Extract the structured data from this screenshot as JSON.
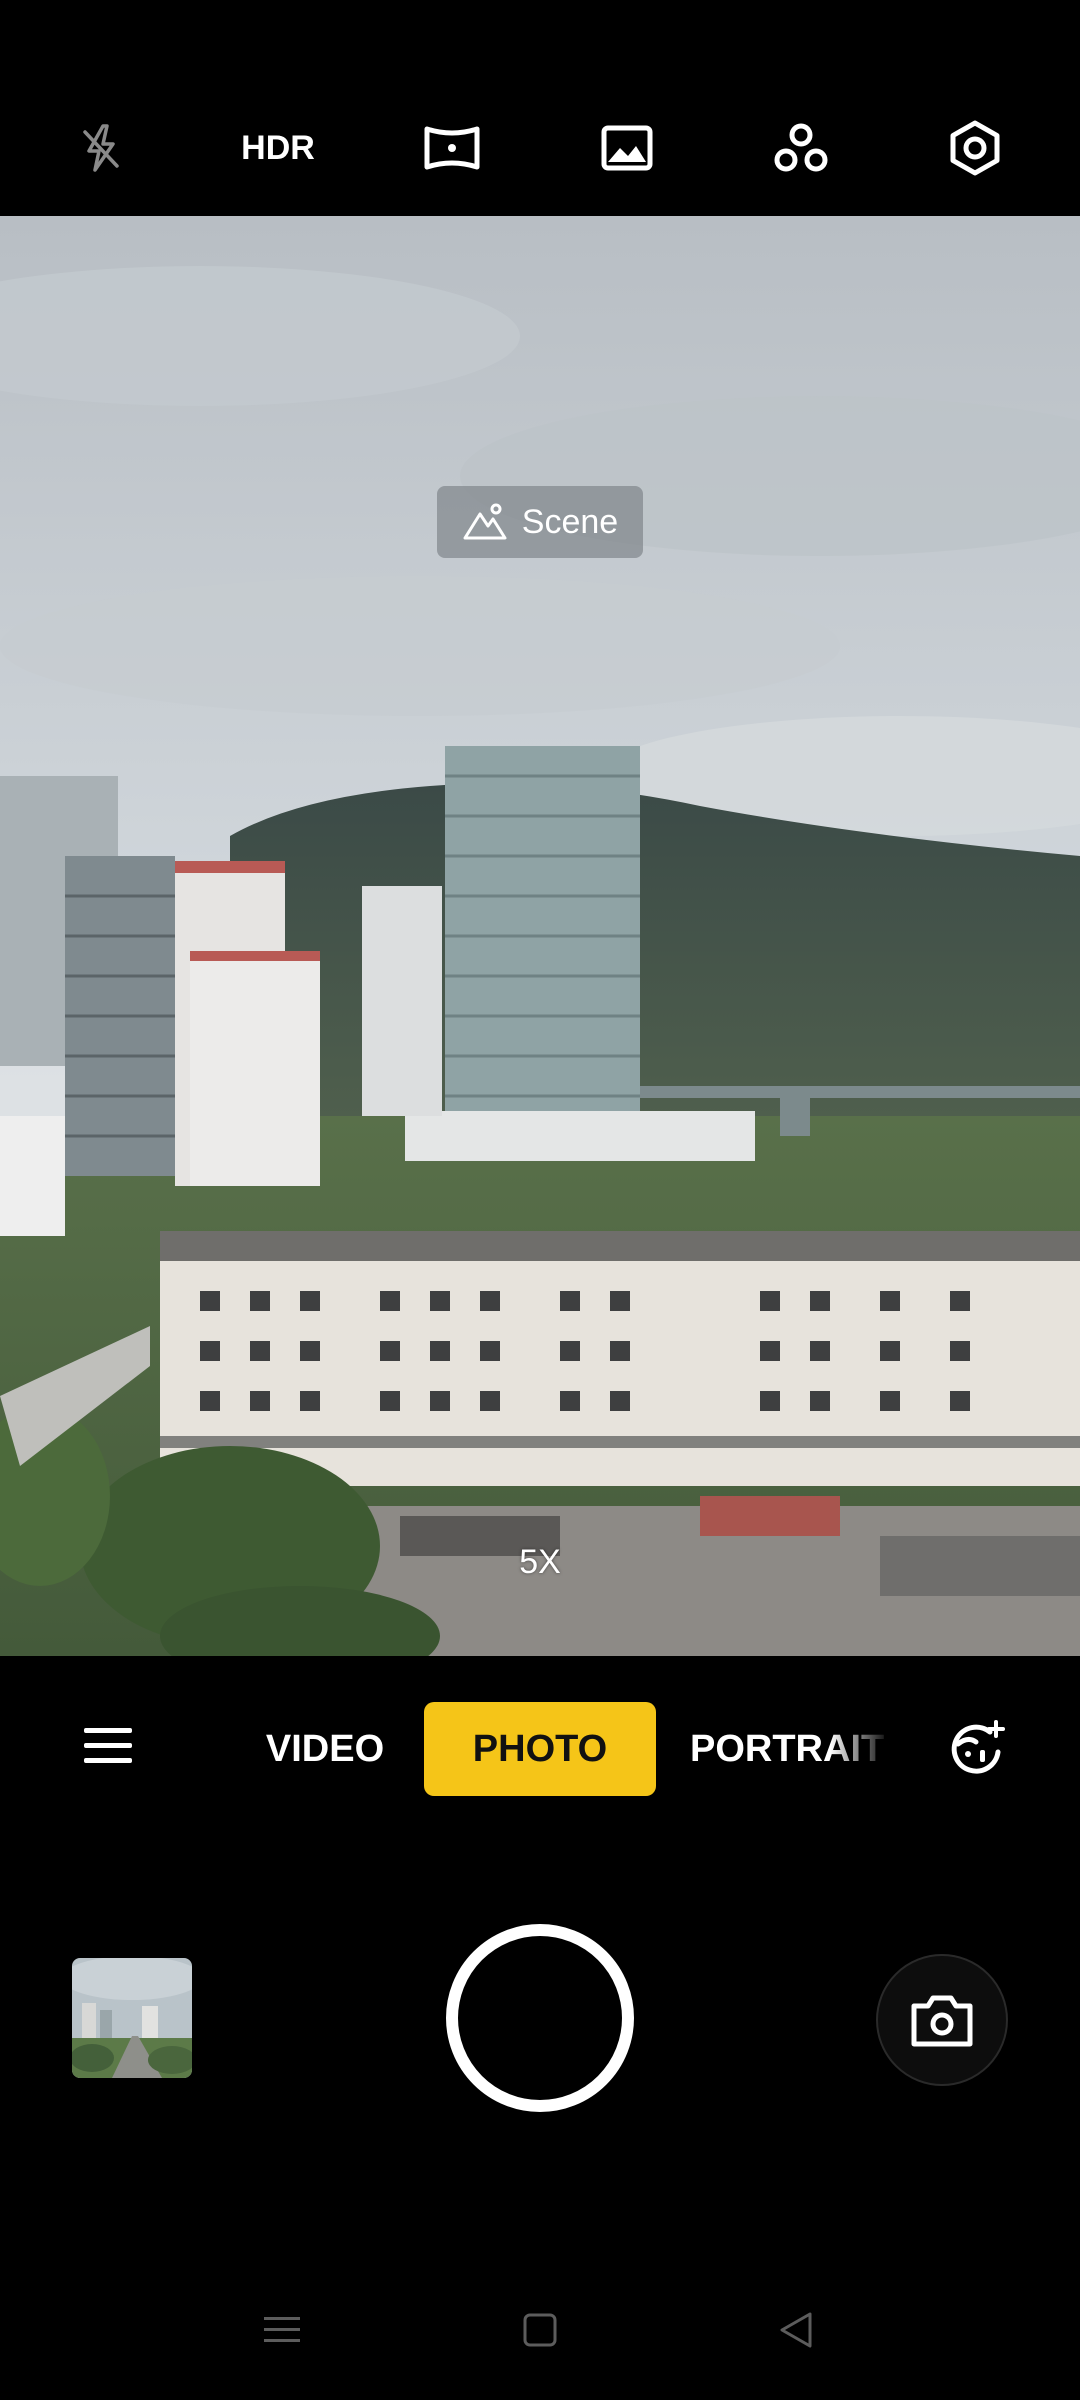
{
  "top_bar": {
    "icons": [
      "flash-off-icon",
      "hdr-toggle",
      "panorama-icon",
      "image-filter-icon",
      "ai-mode-icon",
      "settings-icon"
    ],
    "hdr_label": "HDR"
  },
  "viewfinder": {
    "scene_label": "Scene",
    "scene_icon": "mountain-icon",
    "zoom_label": "5X"
  },
  "modes": {
    "menu_icon": "hamburger-menu-icon",
    "items": [
      "VIDEO",
      "PHOTO",
      "PORTRAIT"
    ],
    "selected": "PHOTO",
    "accent_color": "#f5c518",
    "beauty_icon": "face-retouch-icon"
  },
  "capture": {
    "gallery_icon": "gallery-thumbnail",
    "shutter_icon": "shutter-button",
    "flip_icon": "flip-camera-icon"
  },
  "nav": {
    "items": [
      "recent-apps-icon",
      "home-icon",
      "back-icon"
    ]
  }
}
